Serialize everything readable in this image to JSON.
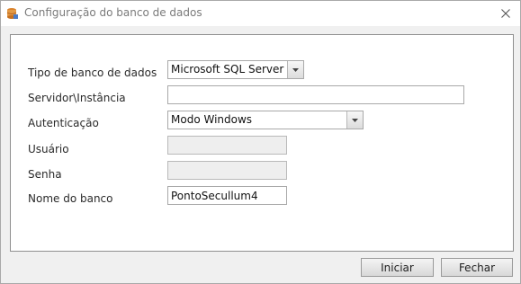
{
  "window": {
    "title": "Configuração do banco de dados"
  },
  "form": {
    "db_type": {
      "label": "Tipo de banco de dados",
      "value": "Microsoft SQL Server"
    },
    "server": {
      "label": "Servidor\\Instância",
      "value": ""
    },
    "auth": {
      "label": "Autenticação",
      "value": "Modo Windows"
    },
    "user": {
      "label": "Usuário",
      "value": ""
    },
    "password": {
      "label": "Senha",
      "value": ""
    },
    "db_name": {
      "label": "Nome do banco",
      "value": "PontoSecullum4"
    }
  },
  "buttons": {
    "start": "Iniciar",
    "close": "Fechar"
  }
}
